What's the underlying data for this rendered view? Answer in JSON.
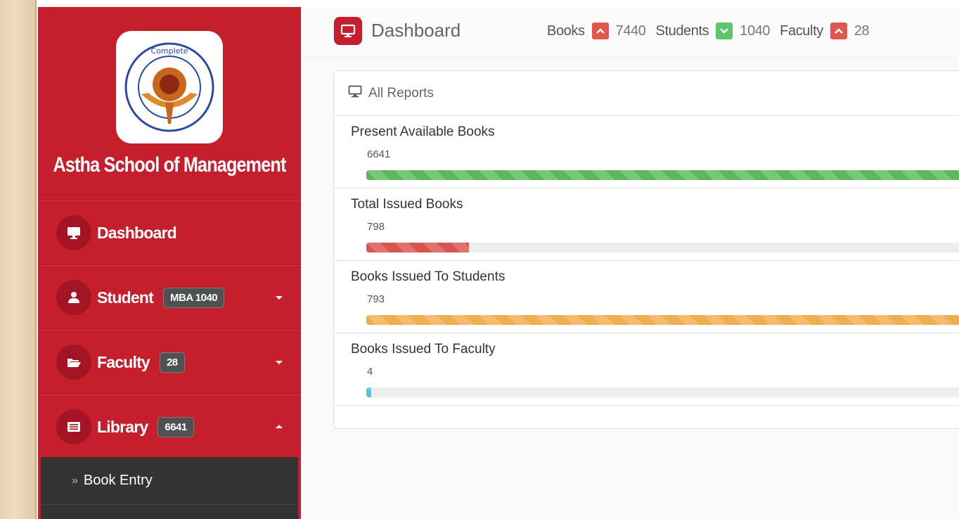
{
  "topbar": {
    "title": "Dashboard",
    "stats": [
      {
        "label": "Books",
        "value": "7440",
        "trend": "up",
        "color": "#e0584c"
      },
      {
        "label": "Students",
        "value": "1040",
        "trend": "down",
        "color": "#5cc76a"
      },
      {
        "label": "Faculty",
        "value": "28",
        "trend": "up",
        "color": "#e0584c"
      }
    ]
  },
  "sidebar": {
    "brand_name": "Astha School of Management",
    "items": [
      {
        "label": "Dashboard",
        "icon": "monitor-icon"
      },
      {
        "label": "Student",
        "badge": "MBA 1040",
        "icon": "user-icon",
        "caret": "down"
      },
      {
        "label": "Faculty",
        "badge": "28",
        "icon": "folder-open-icon",
        "caret": "down"
      },
      {
        "label": "Library",
        "badge": "6641",
        "icon": "list-alt-icon",
        "caret": "up"
      }
    ],
    "submenu": [
      {
        "label": "Book Entry"
      }
    ]
  },
  "panel": {
    "title": "All Reports",
    "reports": [
      {
        "title": "Present Available Books",
        "value": "6641",
        "fraction": 1.0,
        "color": "green"
      },
      {
        "title": "Total Issued Books",
        "value": "798",
        "fraction": 0.17,
        "color": "red"
      },
      {
        "title": "Books Issued To Students",
        "value": "793",
        "fraction": 1.0,
        "color": "orange"
      },
      {
        "title": "Books Issued To Faculty",
        "value": "4",
        "fraction": 0.008,
        "color": "cyan"
      }
    ]
  },
  "colors": {
    "sidebar_bg": "#c51f2e",
    "accent": "#c51f2e"
  }
}
